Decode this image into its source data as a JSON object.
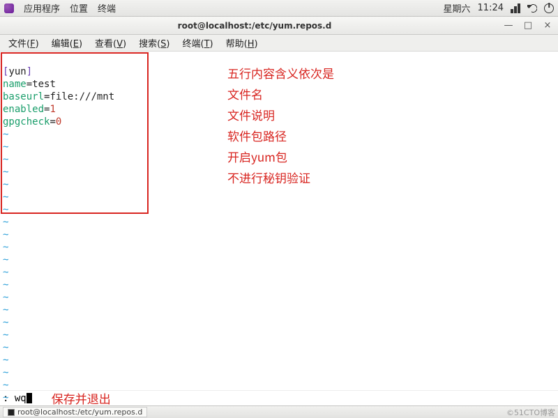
{
  "panel": {
    "menu_apps": "应用程序",
    "menu_places": "位置",
    "menu_terminal": "终端",
    "day_label": "星期六",
    "time_label": "11:24"
  },
  "window": {
    "title": "root@localhost:/etc/yum.repos.d",
    "btn_min": "—",
    "btn_max": "□",
    "btn_close": "×"
  },
  "menubar": {
    "file": "文件(",
    "file_u": "F",
    "file2": ")",
    "edit": "编辑(",
    "edit_u": "E",
    "edit2": ")",
    "view": "查看(",
    "view_u": "V",
    "view2": ")",
    "search": "搜索(",
    "search_u": "S",
    "search2": ")",
    "terminal": "终端(",
    "terminal_u": "T",
    "terminal2": ")",
    "help": "帮助(",
    "help_u": "H",
    "help2": ")"
  },
  "file_lines": {
    "l1_open": "[",
    "l1_name": "yun",
    "l1_close": "]",
    "l2_key": "name",
    "l2_eq": "=",
    "l2_val": "test",
    "l3_key": "baseurl",
    "l3_eq": "=",
    "l3_val": "file:///mnt",
    "l4_key": "enabled",
    "l4_eq": "=",
    "l4_val": "1",
    "l5_key": "gpgcheck",
    "l5_eq": "=",
    "l5_val": "0"
  },
  "tildes": {
    "t": "~"
  },
  "annotations": {
    "a1": "五行内容含义依次是",
    "a2": "文件名",
    "a3": "文件说明",
    "a4": "软件包路径",
    "a5": "开启yum包",
    "a6": "不进行秘钥验证",
    "save": "保存并退出"
  },
  "status": {
    "cmd": ": wq"
  },
  "taskbar": {
    "item": "root@localhost:/etc/yum.repos.d",
    "watermark": "©51CTO博客"
  }
}
